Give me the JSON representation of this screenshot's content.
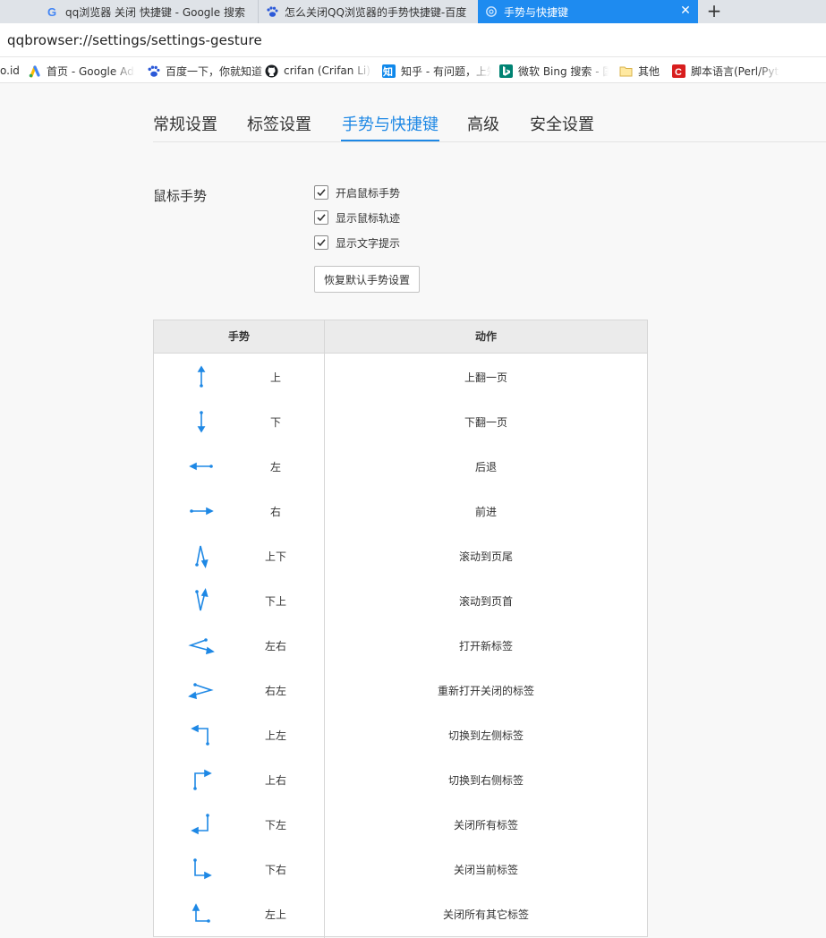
{
  "tabs": [
    {
      "title": "qq浏览器 关闭 快捷键 - Google 搜索",
      "icon": "google-icon",
      "active": false
    },
    {
      "title": "怎么关闭QQ浏览器的手势快捷键-百度",
      "icon": "baidu-paw-icon",
      "active": false
    },
    {
      "title": "手势与快捷键",
      "icon": "settings-gear-icon",
      "active": true
    }
  ],
  "address": {
    "url": "qqbrowser://settings/settings-gesture"
  },
  "bookmarks": [
    {
      "label": "o.id",
      "icon": ""
    },
    {
      "label": "首页 - Google Ads",
      "icon": "google-ads-icon"
    },
    {
      "label": "百度一下，你就知道",
      "icon": "baidu-paw-icon"
    },
    {
      "label": "crifan (Crifan Li) · GitHub",
      "icon": "github-icon"
    },
    {
      "label": "知乎 - 有问题，上知乎",
      "icon": "zhihu-icon"
    },
    {
      "label": "微软 Bing 搜索 - 国内版",
      "icon": "bing-icon"
    },
    {
      "label": "其他",
      "icon": "folder-icon"
    },
    {
      "label": "脚本语言(Perl/Python)",
      "icon": "crifan-c-icon"
    }
  ],
  "nav": {
    "items": [
      "常规设置",
      "标签设置",
      "手势与快捷键",
      "高级",
      "安全设置"
    ],
    "active_index": 2
  },
  "mouse_gesture": {
    "label": "鼠标手势",
    "options": [
      {
        "label": "开启鼠标手势",
        "checked": true
      },
      {
        "label": "显示鼠标轨迹",
        "checked": true
      },
      {
        "label": "显示文字提示",
        "checked": true
      }
    ],
    "reset_button": "恢复默认手势设置"
  },
  "gesture_table": {
    "headers": [
      "手势",
      "动作"
    ],
    "rows": [
      {
        "gesture": "上",
        "action": "上翻一页"
      },
      {
        "gesture": "下",
        "action": "下翻一页"
      },
      {
        "gesture": "左",
        "action": "后退"
      },
      {
        "gesture": "右",
        "action": "前进"
      },
      {
        "gesture": "上下",
        "action": "滚动到页尾"
      },
      {
        "gesture": "下上",
        "action": "滚动到页首"
      },
      {
        "gesture": "左右",
        "action": "打开新标签"
      },
      {
        "gesture": "右左",
        "action": "重新打开关闭的标签"
      },
      {
        "gesture": "上左",
        "action": "切换到左侧标签"
      },
      {
        "gesture": "上右",
        "action": "切换到右侧标签"
      },
      {
        "gesture": "下左",
        "action": "关闭所有标签"
      },
      {
        "gesture": "下右",
        "action": "关闭当前标签"
      },
      {
        "gesture": "左上",
        "action": "关闭所有其它标签"
      }
    ]
  },
  "colors": {
    "accent": "#1e88e5",
    "tab_active": "#1e8bf0",
    "gesture_icon": "#1e88e5"
  }
}
